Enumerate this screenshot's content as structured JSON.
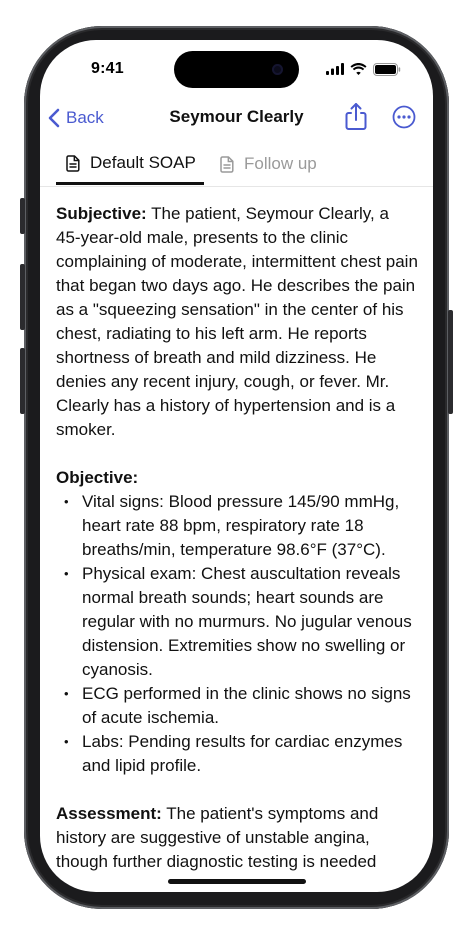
{
  "status": {
    "time": "9:41"
  },
  "nav": {
    "back_label": "Back",
    "title": "Seymour Clearly"
  },
  "tabs": [
    {
      "label": "Default SOAP",
      "active": true
    },
    {
      "label": "Follow up",
      "active": false
    }
  ],
  "note": {
    "subjective": {
      "label": "Subjective:",
      "text": " The patient, Seymour Clearly, a 45-year-old male, presents to the clinic complaining of moderate, intermittent chest pain that began two days ago. He describes the pain as a \"squeezing sensation\" in the center of his chest, radiating to his left arm. He reports shortness of breath and mild dizziness. He denies any recent injury, cough, or fever. Mr. Clearly has a history of hypertension and is a smoker."
    },
    "objective": {
      "label": "Objective:",
      "items": [
        "Vital signs: Blood pressure 145/90 mmHg, heart rate 88 bpm, respiratory rate 18 breaths/min, temperature 98.6°F (37°C).",
        "Physical exam: Chest auscultation reveals normal breath sounds; heart sounds are regular with no murmurs. No jugular venous distension. Extremities show no swelling or cyanosis.",
        "ECG performed in the clinic shows no signs of acute ischemia.",
        "Labs: Pending results for cardiac enzymes and lipid profile."
      ]
    },
    "assessment": {
      "label": "Assessment:",
      "text": " The patient's symptoms and history are suggestive of unstable angina, though further diagnostic testing is needed"
    }
  },
  "colors": {
    "accent": "#4a5ad0",
    "inactive_tab": "#9a9a9a",
    "text": "#111111"
  }
}
